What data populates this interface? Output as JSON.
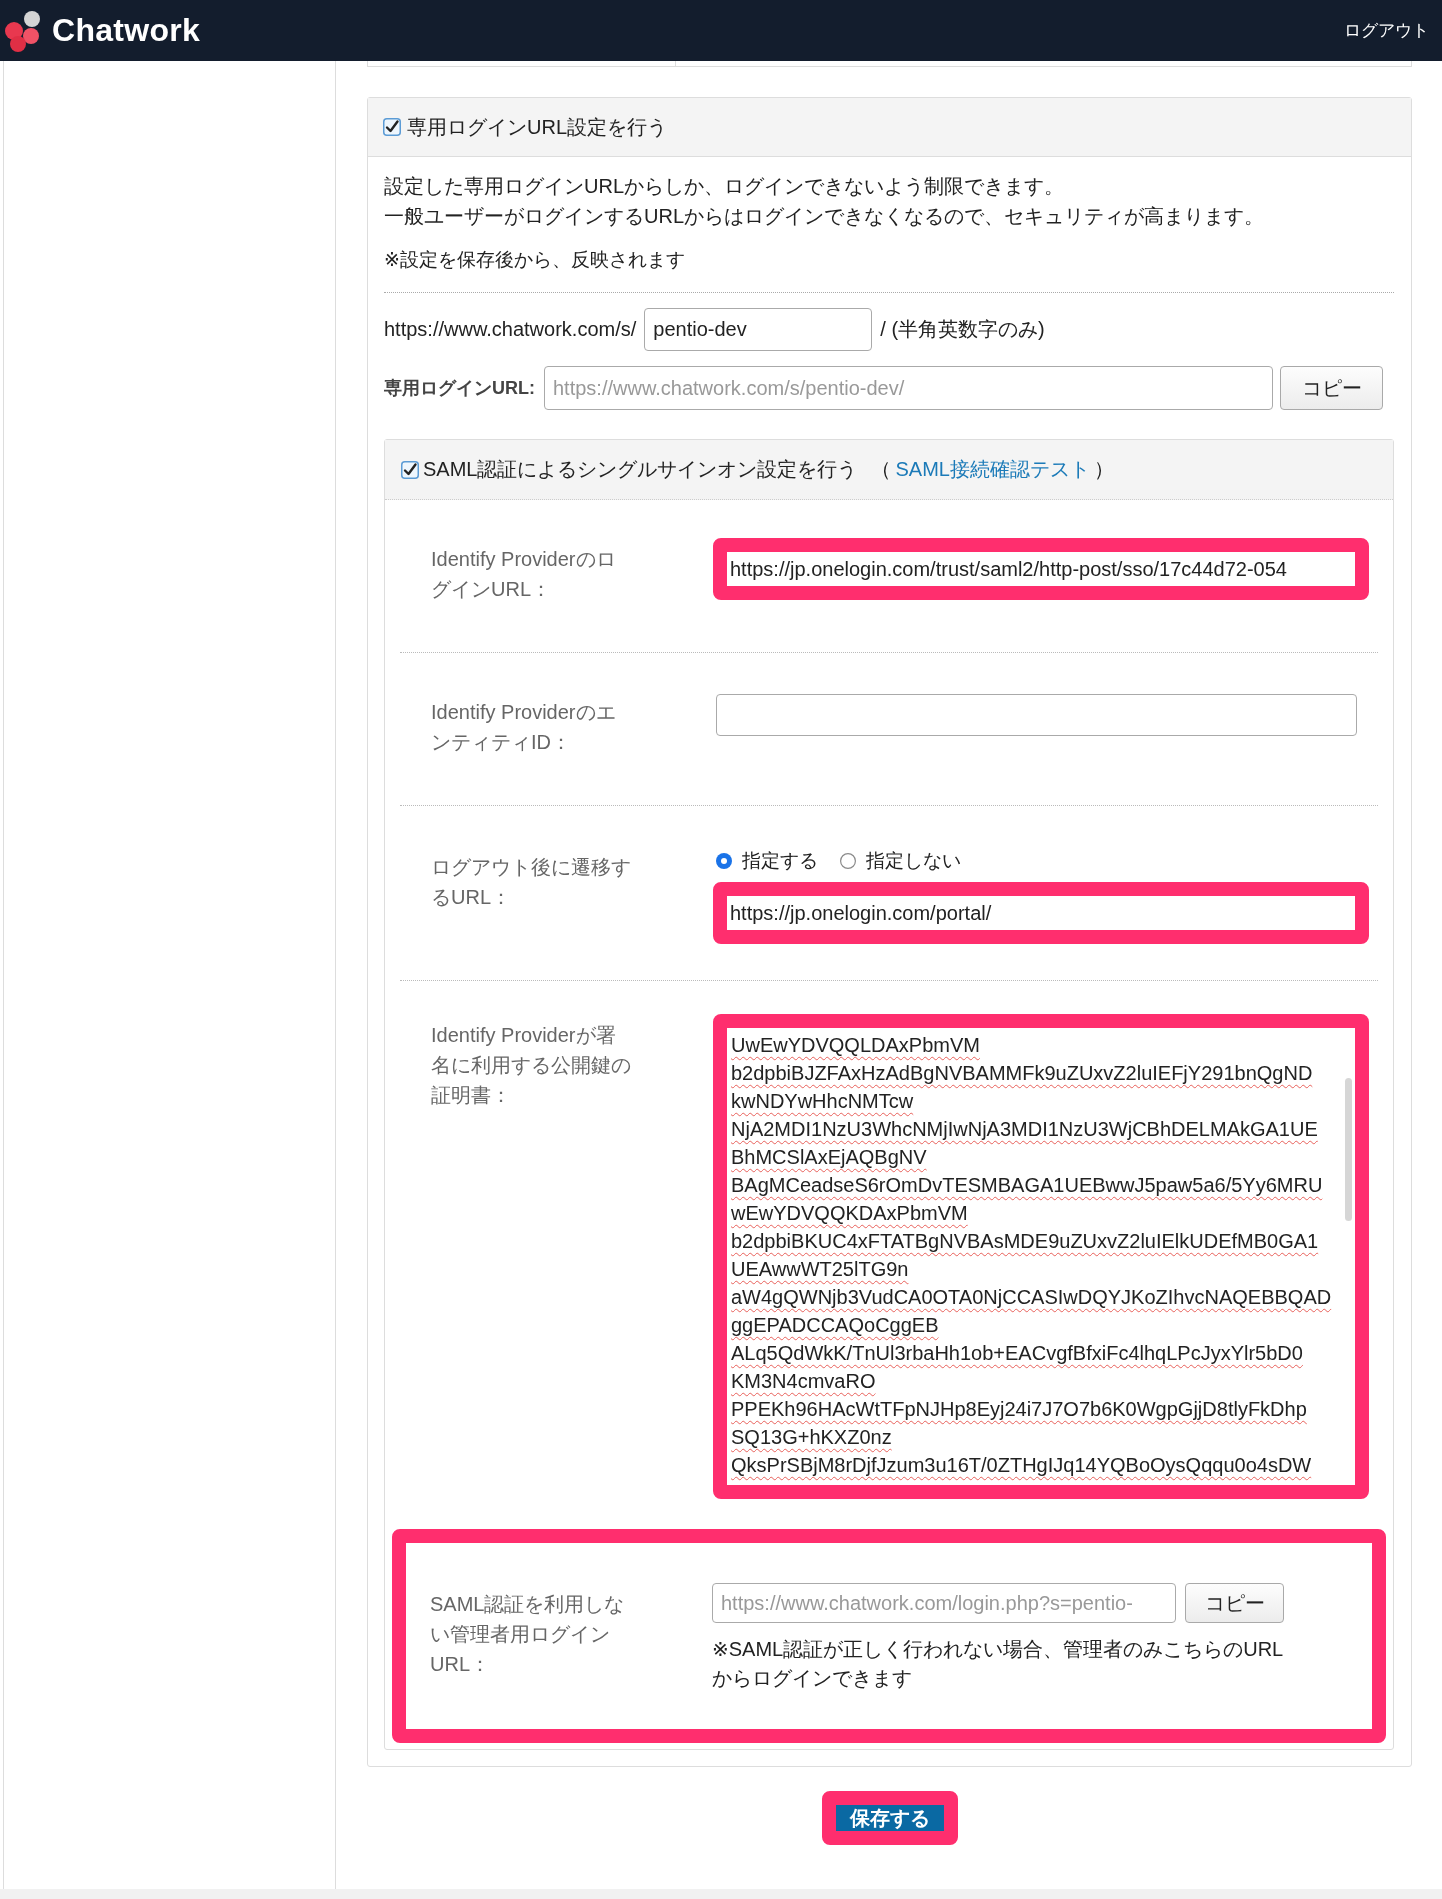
{
  "header": {
    "logo_text": "Chatwork",
    "logout": "ログアウト"
  },
  "login_panel": {
    "checkbox": {
      "label": "専用ログインURL設定を行う",
      "checked": true
    },
    "description": [
      "設定した専用ログインURLからしか、ログインできないよう制限できます。",
      "一般ユーザーがログインするURLからはログインできなくなるので、セキュリティが高まります。"
    ],
    "note": "※設定を保存後から、反映されます",
    "slug_row": {
      "prefix": "https://www.chatwork.com/s/",
      "value": "pentio-dev",
      "suffix": "/ (半角英数字のみ)"
    },
    "url_row": {
      "label": "専用ログインURL:",
      "value": "https://www.chatwork.com/s/pentio-dev/",
      "readonly": true,
      "button": "コピー"
    }
  },
  "saml_panel": {
    "checkbox": {
      "label": "SAML認証によるシングルサインオン設定を行う",
      "checked": true
    },
    "open_paren": "（",
    "test_link": "SAML接続確認テスト",
    "close_paren": "）",
    "rows": [
      {
        "kind": "text",
        "label": "Identify ProviderのログインURL：",
        "value": "https://jp.onelogin.com/trust/saml2/http-post/sso/17c44d72-054",
        "readonly": false,
        "highlighted": true
      },
      {
        "kind": "text",
        "label": "Identify ProviderのエンティティID：",
        "highlighted": false
      },
      {
        "kind": "choice",
        "label": "ログアウト後に遷移するURL：",
        "options": [
          {
            "label": "指定する",
            "selected": true
          },
          {
            "label": "指定しない",
            "selected": false
          }
        ],
        "value": "https://jp.onelogin.com/portal/",
        "readonly": false,
        "highlighted": true
      },
      {
        "kind": "certificate",
        "label": "Identify Providerが署名に利用する公開鍵の証明書：",
        "lines": [
          "UwEwYDVQQLDAxPbmVM",
          "b2dpbiBJZFAxHzAdBgNVBAMMFk9uZUxvZ2luIEFjY291bnQgND",
          "kwNDYwHhcNMTcw",
          "NjA2MDI1NzU3WhcNMjIwNjA3MDI1NzU3WjCBhDELMAkGA1UE",
          "BhMCSlAxEjAQBgNV",
          "BAgMCeadseS6rOmDvTESMBAGA1UEBwwJ5paw5a6/5Yy6MRU",
          "wEwYDVQQKDAxPbmVM",
          "b2dpbiBKUC4xFTATBgNVBAsMDE9uZUxvZ2luIElkUDEfMB0GA1",
          "UEAwwWT25lTG9n",
          "aW4gQWNjb3VudCA0OTA0NjCCASIwDQYJKoZIhvcNAQEBBQAD",
          "ggEPADCCAQoCggEB",
          "ALq5QdWkK/TnUl3rbaHh1ob+EACvgfBfxiFc4lhqLPcJyxYlr5bD0",
          "KM3N4cmvaRO",
          "PPEKh96HAcWtTFpNJHp8Eyj24i7J7O7b6K0WgpGjjD8tlyFkDhp",
          "SQ13G+hKXZ0nz",
          "QksPrSBjM8rDjfJzum3u16T/0ZTHgIJq14YQBoOysQqqu0o4sDW"
        ],
        "readonly": false,
        "highlighted": true
      },
      {
        "kind": "copy",
        "label": "SAML認証を利用しない管理者用ログインURL：",
        "value": "https://www.chatwork.com/login.php?s=pentio-",
        "readonly": true,
        "button": "コピー",
        "note": "※SAML認証が正しく行われない場合、管理者のみこちらのURLからログインできます",
        "highlighted": true
      }
    ]
  },
  "save_button": {
    "label": "保存する",
    "highlighted": true
  }
}
